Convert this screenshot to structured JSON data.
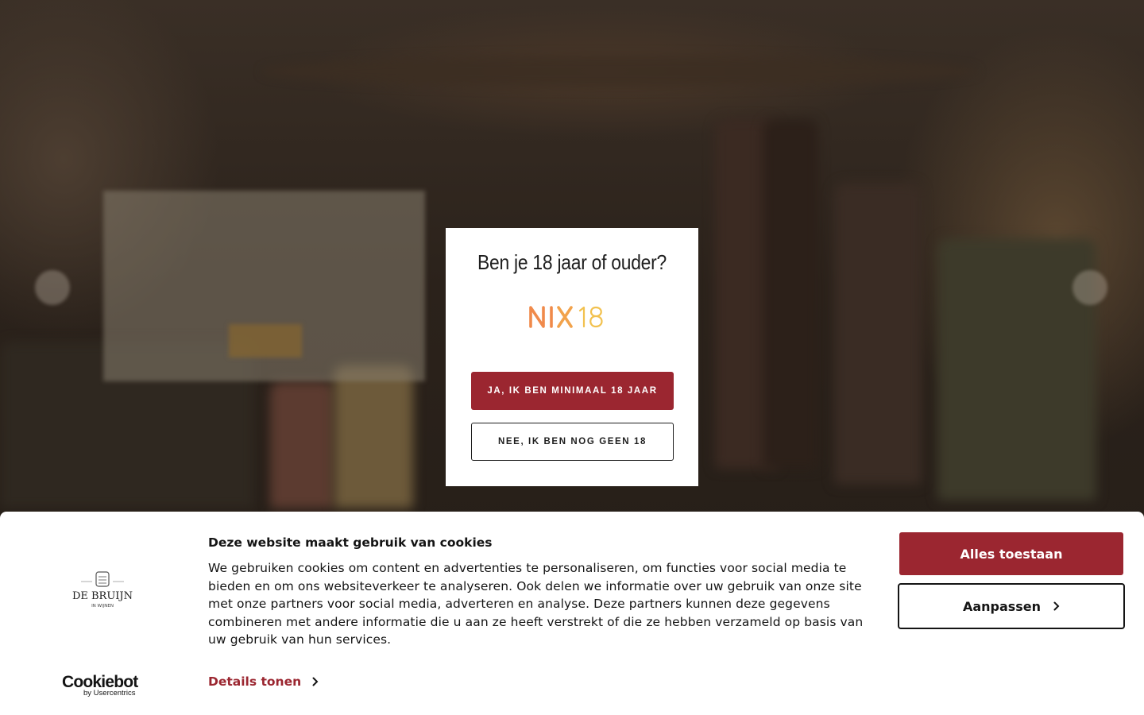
{
  "age_gate": {
    "title": "Ben je 18 jaar of ouder?",
    "logo_icon": "nix18-logo",
    "yes_label": "JA, IK BEN MINIMAAL 18 JAAR",
    "no_label": "NEE, IK BEN NOG GEEN 18"
  },
  "cookie_banner": {
    "title": "Deze website maakt gebruik van cookies",
    "body": "We gebruiken cookies om content en advertenties te personaliseren, om functies voor social media te bieden en om ons websiteverkeer te analyseren. Ook delen we informatie over uw gebruik van onze site met onze partners voor social media, adverteren en analyse. Deze partners kunnen deze gegevens combineren met andere informatie die u aan ze heeft verstrekt of die ze hebben verzameld op basis van uw gebruik van hun services.",
    "details_label": "Details tonen",
    "allow_all_label": "Alles toestaan",
    "customize_label": "Aanpassen",
    "brand_logo_text": "DE BRUIJN",
    "brand_logo_sub": "IN WIJNEN",
    "cookiebot_name": "Cookiebot",
    "cookiebot_sub": "by Usercentrics"
  },
  "colors": {
    "accent": "#9b2630",
    "nix_orange": "#f08a4b",
    "nix_yellow": "#f2c14e"
  }
}
